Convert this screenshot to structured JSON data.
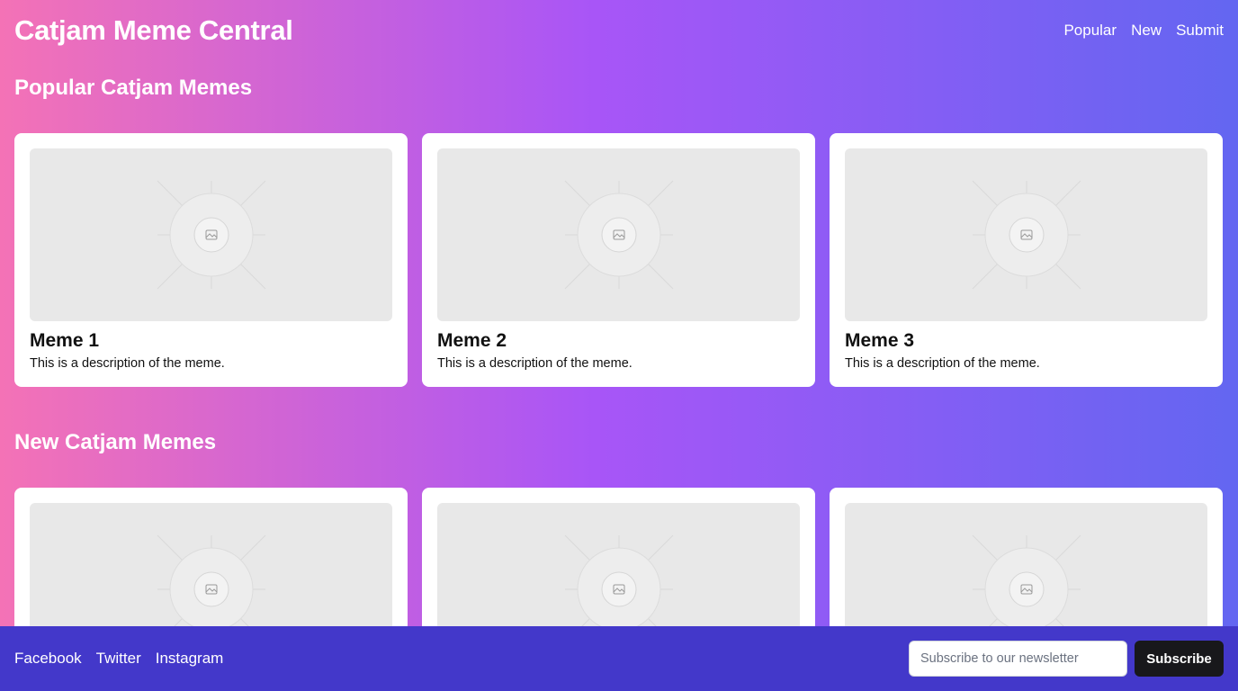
{
  "header": {
    "title": "Catjam Meme Central",
    "nav": [
      "Popular",
      "New",
      "Submit"
    ]
  },
  "popular": {
    "heading": "Popular Catjam Memes",
    "cards": [
      {
        "title": "Meme 1",
        "description": "This is a description of the meme."
      },
      {
        "title": "Meme 2",
        "description": "This is a description of the meme."
      },
      {
        "title": "Meme 3",
        "description": "This is a description of the meme."
      }
    ]
  },
  "new": {
    "heading": "New Catjam Memes",
    "cards": [
      {
        "title": "",
        "description": ""
      },
      {
        "title": "",
        "description": ""
      },
      {
        "title": "",
        "description": ""
      }
    ]
  },
  "footer": {
    "social": [
      "Facebook",
      "Twitter",
      "Instagram"
    ],
    "newsletter_placeholder": "Subscribe to our newsletter",
    "subscribe_label": "Subscribe"
  },
  "colors": {
    "gradient_start": "#f472b6",
    "gradient_mid": "#a855f7",
    "gradient_end": "#6366f1",
    "footer_bg": "#4338ca",
    "button_bg": "#18181b"
  },
  "icons": {
    "placeholder": "image-placeholder-icon"
  }
}
